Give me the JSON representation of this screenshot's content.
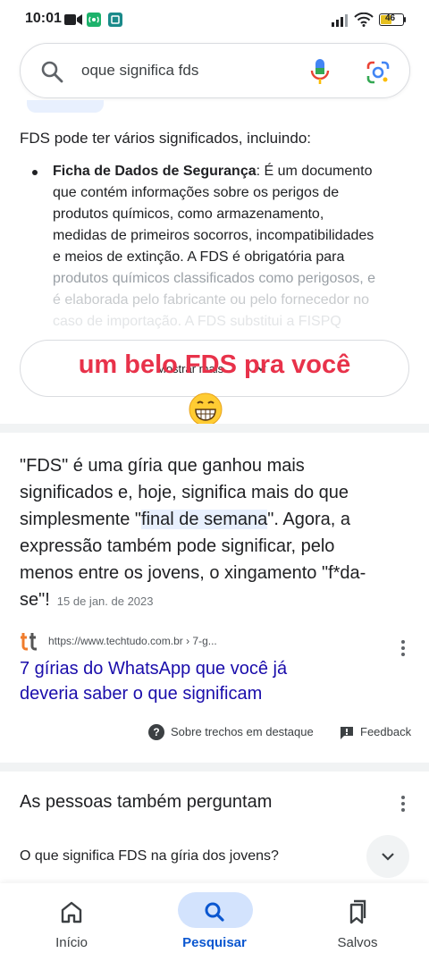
{
  "status_bar": {
    "time": "10:01",
    "battery_level": "46"
  },
  "search": {
    "query": "oque significa fds"
  },
  "featured": {
    "intro": "FDS pode ter vários significados, incluindo:",
    "bullet_term": "Ficha de Dados de Segurança",
    "bullet_lines": [
      ": É um documento",
      "que contém informações sobre os perigos de",
      "produtos químicos, como armazenamento,",
      "medidas de primeiros socorros, incompatibilidades",
      "e meios de extinção. A FDS é obrigatória para",
      "produtos químicos classificados como perigosos, e",
      "é elaborada pelo fabricante ou pelo fornecedor no",
      "caso de importação. A FDS substitui a FISPQ"
    ],
    "show_more_label": "Mostrar mais",
    "overlay_text": "um belo FDS pra você"
  },
  "snippet": {
    "line1": "\"FDS\" é uma gíria que ganhou mais",
    "line2": "significados e, hoje, significa mais do que",
    "line3_pre": "simplesmente \"",
    "line3_highlight": "final de semana",
    "line3_post": "\". Agora, a",
    "line4": "expressão também pode significar, pelo",
    "line5": "menos entre os jovens, o xingamento \"f*da-",
    "line6": "se\"!",
    "date": "15 de jan. de 2023"
  },
  "result": {
    "logo_text": "tt",
    "url": "https://www.techtudo.com.br › 7-g...",
    "title_line1": "7 gírias do WhatsApp que você já",
    "title_line2": "deveria saber o que significam"
  },
  "about_snippets": "Sobre trechos em destaque",
  "feedback": "Feedback",
  "people_also_ask": {
    "title": "As pessoas também perguntam",
    "question": "O que significa FDS na gíria dos jovens?"
  },
  "bottom_nav": {
    "home": "Início",
    "search": "Pesquisar",
    "saved": "Salvos"
  },
  "colors": {
    "link": "#1a0dab",
    "accent": "#0b57d0",
    "overlay": "#e8324a"
  }
}
